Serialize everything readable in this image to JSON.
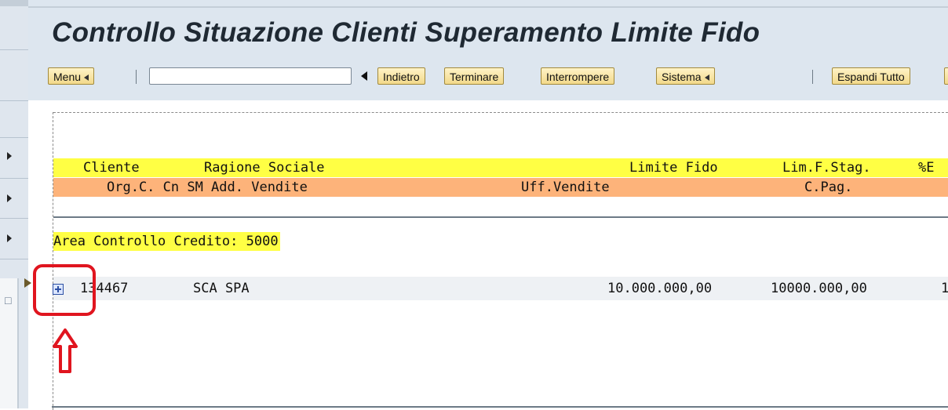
{
  "window": {
    "title": "Controllo Situazione Clienti Superamento Limite Fido"
  },
  "toolbar": {
    "menu_label": "Menu",
    "command_field_value": "",
    "back_label": "Indietro",
    "exit_label": "Terminare",
    "cancel_label": "Interrompere",
    "system_label": "Sistema",
    "expand_all_label": "Espandi Tutto"
  },
  "report": {
    "header1": {
      "cliente": "Cliente",
      "ragione_sociale": "Ragione Sociale",
      "limite_fido": "Limite Fido",
      "lim_f_stag": "Lim.F.Stag.",
      "perc": "%E"
    },
    "header2": {
      "org_fields": "Org.C. Cn SM Add. Vendite",
      "uff_vendite": "Uff.Vendite",
      "c_pag": "C.Pag."
    },
    "area_label": "Area Controllo Credito: 5000",
    "rows": [
      {
        "cliente": "134467",
        "ragione_sociale": "SCA SPA",
        "limite_fido": "10.000.000,00",
        "lim_f_stag": "10000.000,00",
        "perc": "1"
      }
    ]
  },
  "icons": {
    "expand": "expand-node-icon",
    "annotation": "red-up-arrow"
  },
  "colors": {
    "header_yellow": "#ffff44",
    "header_orange": "#fdb37a",
    "annotation_red": "#e0151f",
    "button_gold": "#f2d98a"
  }
}
